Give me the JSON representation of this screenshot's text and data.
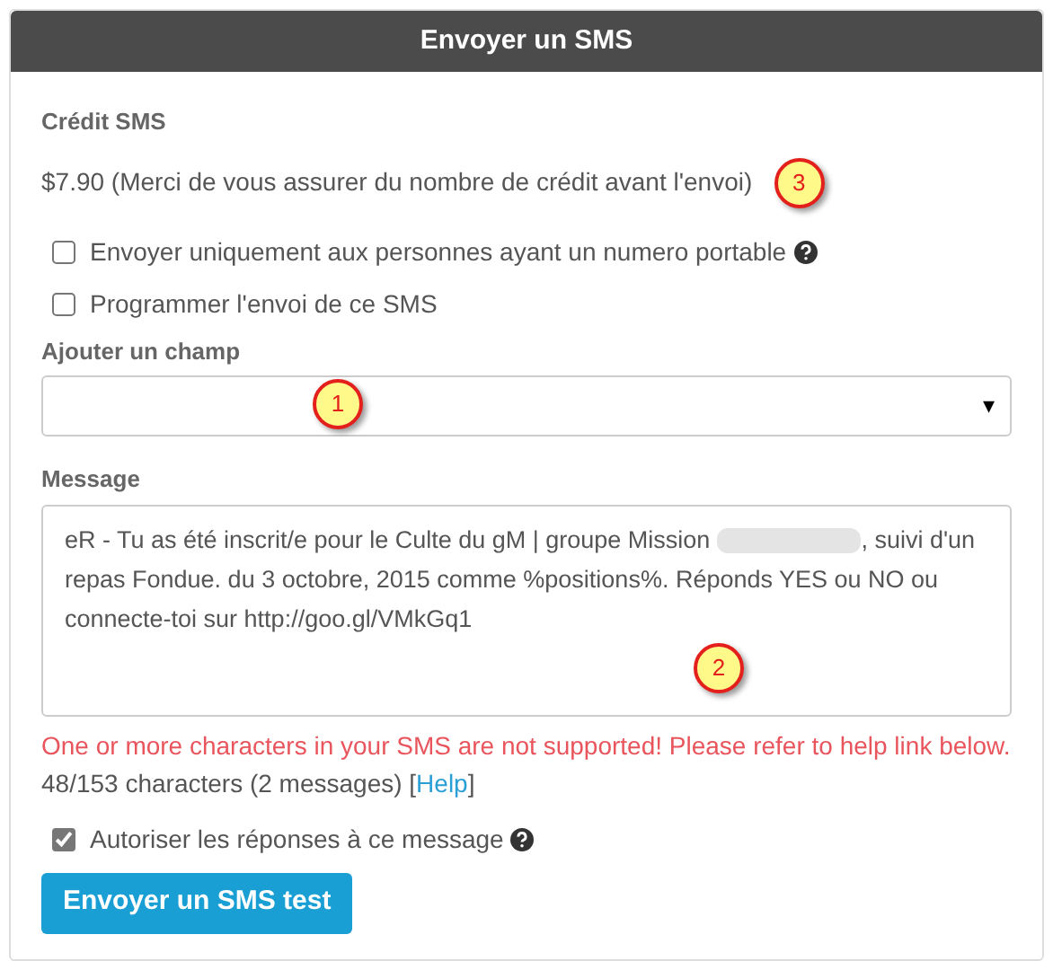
{
  "panel": {
    "title": "Envoyer un SMS"
  },
  "credit": {
    "label": "Crédit SMS",
    "text": "$7.90 (Merci de vous assurer du nombre de crédit avant l'envoi)"
  },
  "options": [
    {
      "label": "Envoyer uniquement aux personnes ayant un numero portable",
      "checked": false,
      "help": true
    },
    {
      "label": "Programmer l'envoi de ce SMS",
      "checked": false,
      "help": false
    }
  ],
  "field_select": {
    "label": "Ajouter un champ",
    "caret": "▾"
  },
  "message": {
    "label": "Message",
    "text_before": "eR - Tu as été inscrit/e pour le Culte du gM | groupe Mission",
    "redacted": true,
    "text_after": ", suivi d'un repas Fondue. du 3 octobre, 2015 comme %positions%. Réponds YES ou NO ou connecte-toi sur http://goo.gl/VMkGq1"
  },
  "error": "One or more characters in your SMS are not supported! Please refer to help link below.",
  "counter": {
    "text": "48/153 characters (2 messages) [",
    "link": "Help",
    "end": "]"
  },
  "reply_option": {
    "label": "Autoriser les réponses à ce message",
    "checked": true,
    "help": true
  },
  "test_button": "Envoyer un SMS test",
  "callouts": [
    "3",
    "1",
    "2"
  ]
}
